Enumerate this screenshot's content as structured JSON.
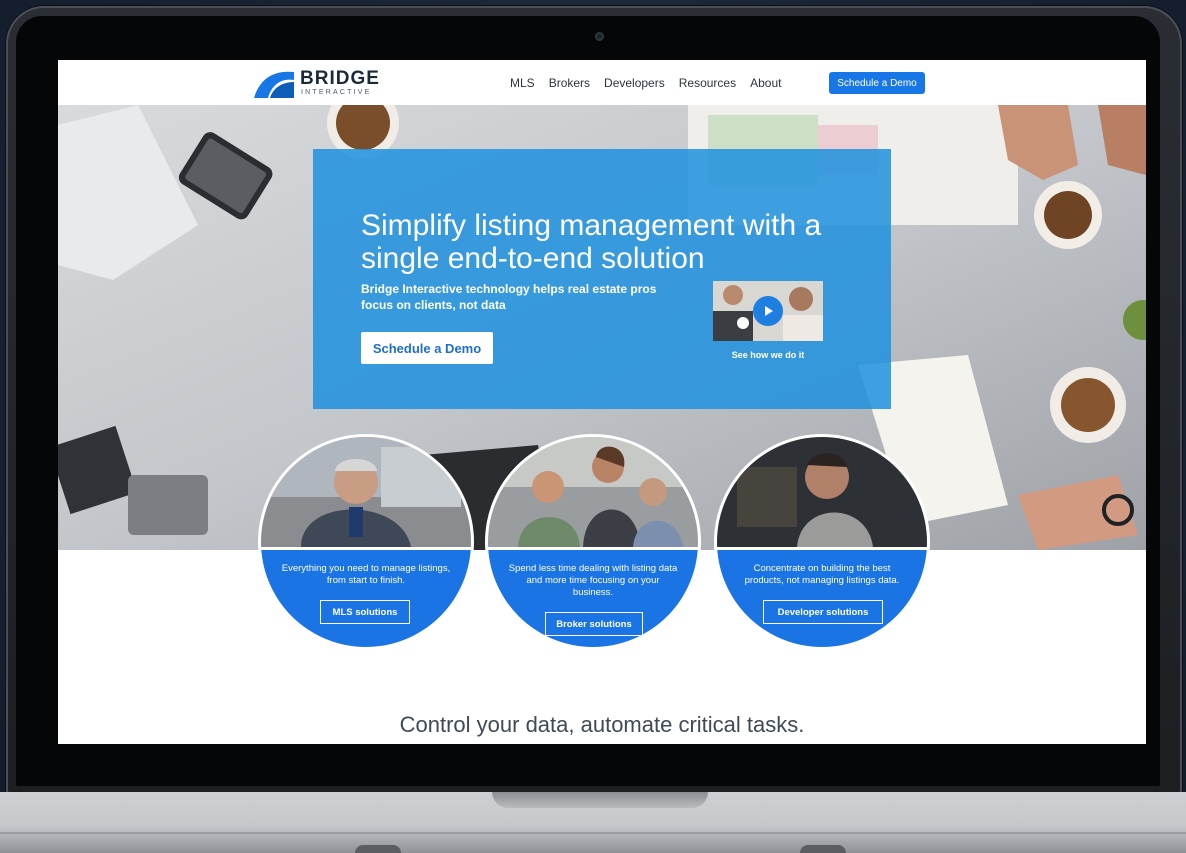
{
  "nav": {
    "logo_title": "BRIDGE",
    "logo_subtitle": "INTERACTIVE",
    "links": [
      "MLS",
      "Brokers",
      "Developers",
      "Resources",
      "About"
    ],
    "cta_label": "Schedule a Demo"
  },
  "hero": {
    "title": "Simplify listing management with a single end-to-end solution",
    "subtitle": "Bridge Interactive technology helps real estate pros focus on clients, not data",
    "button_label": "Schedule a Demo",
    "video_caption": "See how we do it"
  },
  "solutions": [
    {
      "text": "Everything you need to manage listings, from start to finish.",
      "button": "MLS solutions"
    },
    {
      "text": "Spend less time dealing with listing data and more time focusing on your business.",
      "button": "Broker solutions"
    },
    {
      "text": "Concentrate on building the best products, not managing listings data.",
      "button": "Developer solutions"
    }
  ],
  "tagline": "Control your data, automate critical tasks.",
  "colors": {
    "accent_blue": "#1877e6",
    "hero_panel": "#2092de",
    "circle_blue": "#1b74e4",
    "logo_dark": "#1b2a3a"
  },
  "icons": [
    "bridge-logo-icon",
    "play-icon"
  ]
}
